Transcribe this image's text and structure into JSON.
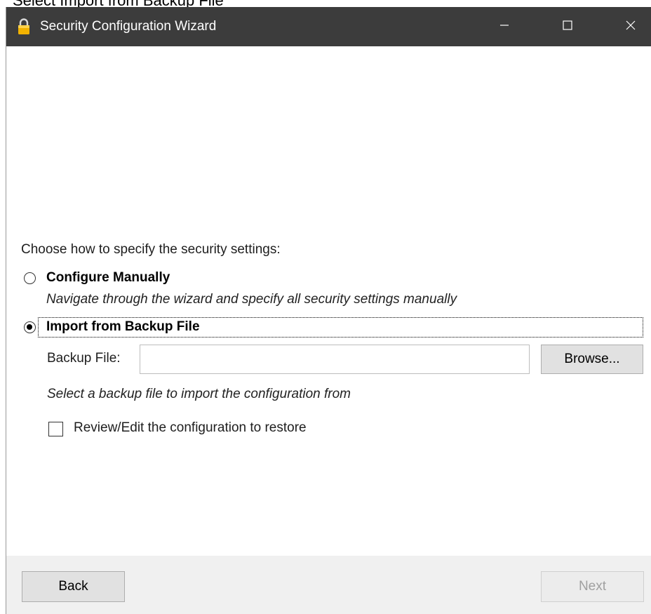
{
  "caption": "Select Import from Backup File",
  "window": {
    "title": "Security Configuration Wizard",
    "controls": {
      "minimize_icon": "minimize-icon",
      "maximize_icon": "maximize-icon",
      "close_icon": "close-icon"
    }
  },
  "content": {
    "prompt": "Choose how to specify the security settings:",
    "options": [
      {
        "label": "Configure Manually",
        "description": "Navigate through the wizard and specify all security settings manually",
        "selected": false
      },
      {
        "label": "Import from Backup File",
        "selected": true
      }
    ],
    "backup_file": {
      "label": "Backup File:",
      "value": "",
      "browse_label": "Browse...",
      "hint": "Select a backup file to import the configuration from"
    },
    "review_checkbox": {
      "label": "Review/Edit the configuration to restore",
      "checked": false
    }
  },
  "footer": {
    "back_label": "Back",
    "next_label": "Next",
    "next_enabled": false
  },
  "colors": {
    "titlebar": "#3c3c3c",
    "footer": "#f0f0f0",
    "button": "#e1e1e1"
  }
}
